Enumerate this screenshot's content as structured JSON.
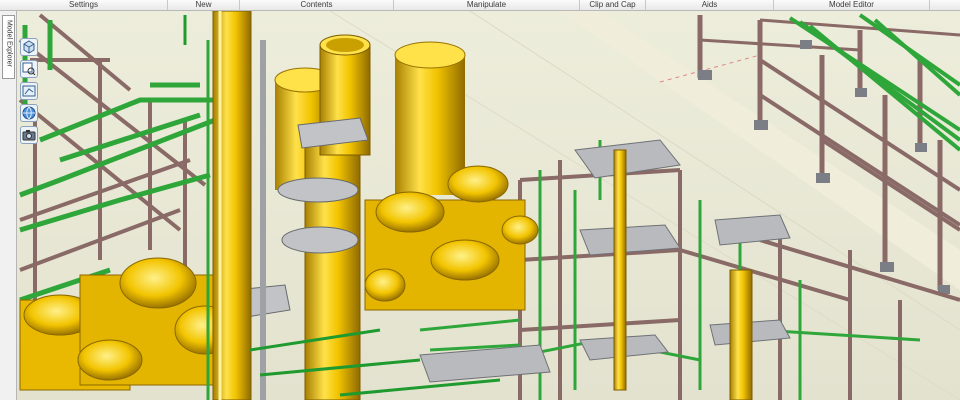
{
  "ribbon": {
    "groups": [
      {
        "label": "Settings"
      },
      {
        "label": "New"
      },
      {
        "label": "Contents"
      },
      {
        "label": "Manipulate"
      },
      {
        "label": "Clip and Cap"
      },
      {
        "label": "Aids"
      },
      {
        "label": "Model Editor"
      }
    ]
  },
  "sidebar": {
    "tab_label": "Model Explorer"
  },
  "tools": [
    {
      "icon": "view-orientation-icon"
    },
    {
      "icon": "select-search-icon"
    },
    {
      "icon": "zoom-frame-icon"
    },
    {
      "icon": "globe-navigate-icon"
    },
    {
      "icon": "camera-icon"
    }
  ],
  "colors": {
    "vessel_yellow": "#f2c400",
    "pipe_green": "#1f9a2e",
    "steel_brown": "#8a6a66",
    "grating_grey": "#a9acb0",
    "ground": "#e9e8d6"
  }
}
